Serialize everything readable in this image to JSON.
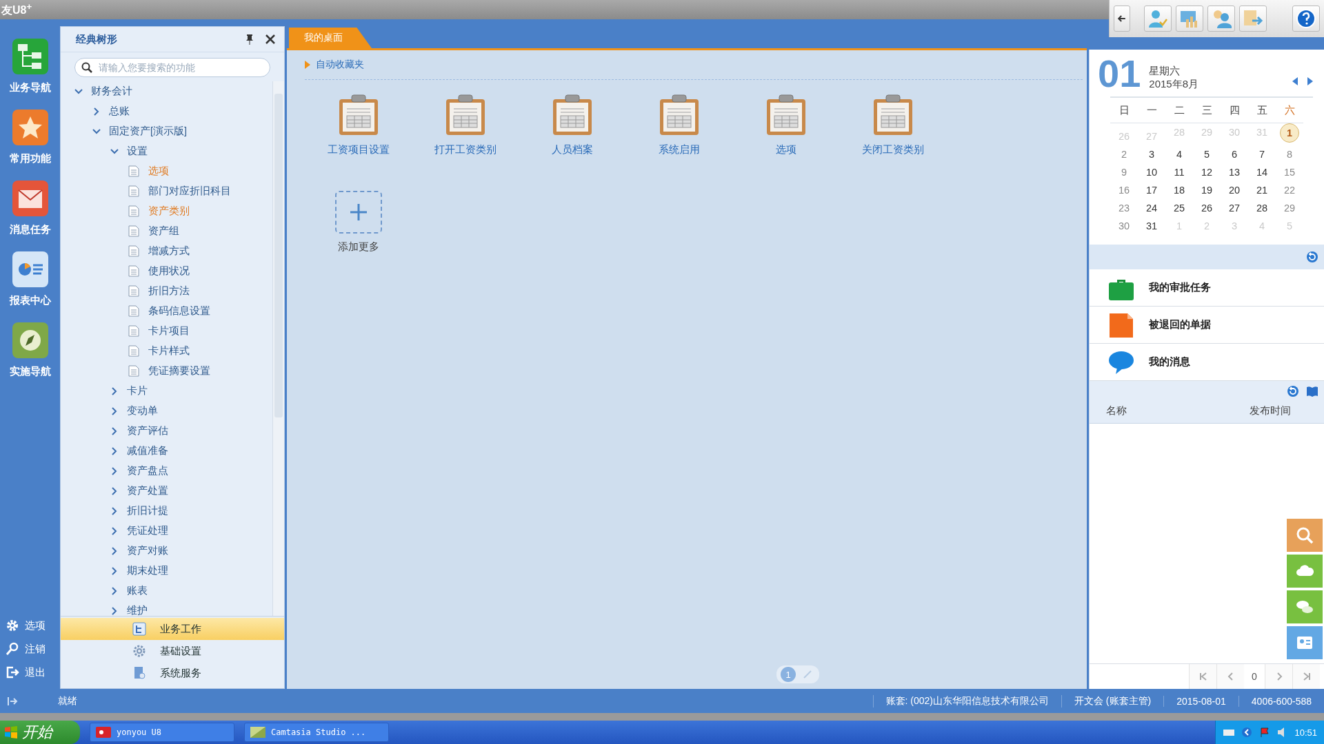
{
  "app_title": "友U8$^{+}$",
  "nav_rail": {
    "items": [
      {
        "label": "业务导航",
        "kind": "tree"
      },
      {
        "label": "常用功能",
        "kind": "star"
      },
      {
        "label": "消息任务",
        "kind": "mail"
      },
      {
        "label": "报表中心",
        "kind": "report"
      },
      {
        "label": "实施导航",
        "kind": "compass"
      }
    ],
    "bottom": [
      {
        "label": "选项",
        "kind": "gear"
      },
      {
        "label": "注销",
        "kind": "key"
      },
      {
        "label": "退出",
        "kind": "exit"
      }
    ]
  },
  "tree_panel": {
    "title": "经典树形",
    "search": {
      "placeholder": "请输入您要搜索的功能"
    },
    "tree": [
      {
        "label": "财务会计",
        "expanded": true,
        "children": [
          {
            "label": "总账",
            "expanded": false
          },
          {
            "label": "固定资产[演示版]",
            "expanded": true,
            "children": [
              {
                "label": "设置",
                "expanded": true,
                "children": [
                  {
                    "label": "选项",
                    "highlighted": true
                  },
                  {
                    "label": "部门对应折旧科目",
                    "highlighted": false
                  },
                  {
                    "label": "资产类别",
                    "highlighted": true
                  },
                  {
                    "label": "资产组",
                    "highlighted": false
                  },
                  {
                    "label": "增减方式",
                    "highlighted": false
                  },
                  {
                    "label": "使用状况",
                    "highlighted": false
                  },
                  {
                    "label": "折旧方法",
                    "highlighted": false
                  },
                  {
                    "label": "条码信息设置",
                    "highlighted": false
                  },
                  {
                    "label": "卡片项目",
                    "highlighted": false
                  },
                  {
                    "label": "卡片样式",
                    "highlighted": false
                  },
                  {
                    "label": "凭证摘要设置",
                    "highlighted": false
                  }
                ]
              },
              {
                "label": "卡片",
                "expanded": false
              },
              {
                "label": "变动单",
                "expanded": false
              },
              {
                "label": "资产评估",
                "expanded": false
              },
              {
                "label": "减值准备",
                "expanded": false
              },
              {
                "label": "资产盘点",
                "expanded": false
              },
              {
                "label": "资产处置",
                "expanded": false
              },
              {
                "label": "折旧计提",
                "expanded": false
              },
              {
                "label": "凭证处理",
                "expanded": false
              },
              {
                "label": "资产对账",
                "expanded": false
              },
              {
                "label": "期末处理",
                "expanded": false
              },
              {
                "label": "账表",
                "expanded": false
              },
              {
                "label": "维护",
                "expanded": false
              }
            ]
          }
        ]
      }
    ],
    "modules": [
      {
        "label": "业务工作",
        "kind": "work",
        "selected": true
      },
      {
        "label": "基础设置",
        "kind": "gear",
        "selected": false
      },
      {
        "label": "系统服务",
        "kind": "service",
        "selected": false
      }
    ]
  },
  "desktop": {
    "tab": {
      "label": "我的桌面",
      "selected": true
    },
    "section": "自动收藏夹",
    "shortcuts": [
      "工资项目设置",
      "打开工资类别",
      "人员档案",
      "系统启用",
      "选项",
      "关闭工资类别"
    ],
    "add_label": "添加更多",
    "pager": {
      "current": "1"
    }
  },
  "calendar": {
    "day": "01",
    "weekday": "星期六",
    "month": "2015年8月",
    "headers": [
      "日",
      "一",
      "二",
      "三",
      "四",
      "五",
      "六"
    ],
    "weeks": [
      [
        {
          "text": "26",
          "muted": true,
          "selected": false
        },
        {
          "text": "27",
          "muted": true,
          "selected": false
        },
        {
          "text": "28",
          "muted": true,
          "selected": false
        },
        {
          "text": "29",
          "muted": true,
          "selected": false
        },
        {
          "text": "30",
          "muted": true,
          "selected": false
        },
        {
          "text": "31",
          "muted": true,
          "selected": false
        },
        {
          "text": "1",
          "muted": false,
          "selected": true
        }
      ],
      [
        {
          "text": "2",
          "muted": false,
          "selected": false
        },
        {
          "text": "3",
          "muted": false,
          "selected": false
        },
        {
          "text": "4",
          "muted": false,
          "selected": false
        },
        {
          "text": "5",
          "muted": false,
          "selected": false
        },
        {
          "text": "6",
          "muted": false,
          "selected": false
        },
        {
          "text": "7",
          "muted": false,
          "selected": false
        },
        {
          "text": "8",
          "muted": false,
          "selected": false
        }
      ],
      [
        {
          "text": "9",
          "muted": false,
          "selected": false
        },
        {
          "text": "10",
          "muted": false,
          "selected": false
        },
        {
          "text": "11",
          "muted": false,
          "selected": false
        },
        {
          "text": "12",
          "muted": false,
          "selected": false
        },
        {
          "text": "13",
          "muted": false,
          "selected": false
        },
        {
          "text": "14",
          "muted": false,
          "selected": false
        },
        {
          "text": "15",
          "muted": false,
          "selected": false
        }
      ],
      [
        {
          "text": "16",
          "muted": false,
          "selected": false
        },
        {
          "text": "17",
          "muted": false,
          "selected": false
        },
        {
          "text": "18",
          "muted": false,
          "selected": false
        },
        {
          "text": "19",
          "muted": false,
          "selected": false
        },
        {
          "text": "20",
          "muted": false,
          "selected": false
        },
        {
          "text": "21",
          "muted": false,
          "selected": false
        },
        {
          "text": "22",
          "muted": false,
          "selected": false
        }
      ],
      [
        {
          "text": "23",
          "muted": false,
          "selected": false
        },
        {
          "text": "24",
          "muted": false,
          "selected": false
        },
        {
          "text": "25",
          "muted": false,
          "selected": false
        },
        {
          "text": "26",
          "muted": false,
          "selected": false
        },
        {
          "text": "27",
          "muted": false,
          "selected": false
        },
        {
          "text": "28",
          "muted": false,
          "selected": false
        },
        {
          "text": "29",
          "muted": false,
          "selected": false
        }
      ],
      [
        {
          "text": "30",
          "muted": false,
          "selected": false
        },
        {
          "text": "31",
          "muted": false,
          "selected": false
        },
        {
          "text": "1",
          "muted": true,
          "selected": false
        },
        {
          "text": "2",
          "muted": true,
          "selected": false
        },
        {
          "text": "3",
          "muted": true,
          "selected": false
        },
        {
          "text": "4",
          "muted": true,
          "selected": false
        },
        {
          "text": "5",
          "muted": true,
          "selected": false
        }
      ]
    ]
  },
  "tasks": [
    {
      "label": "我的审批任务",
      "kind": "briefcase"
    },
    {
      "label": "被退回的单据",
      "kind": "document"
    },
    {
      "label": "我的消息",
      "kind": "bubble"
    }
  ],
  "notices": {
    "columns": [
      "名称",
      "发布时间"
    ],
    "page": "0"
  },
  "status_bar": {
    "text": "就绪",
    "fields": [
      "账套: (002)山东华阳信息技术有限公司",
      "开文会 (账套主管)",
      "2015-08-01",
      "4006-600-588"
    ]
  },
  "taskbar": {
    "start": "开始",
    "tasks": [
      {
        "label": "yonyou U8",
        "kind": "u8"
      },
      {
        "label": "Camtasia Studio ...",
        "kind": "camtasia"
      }
    ],
    "clock": "10:51"
  }
}
